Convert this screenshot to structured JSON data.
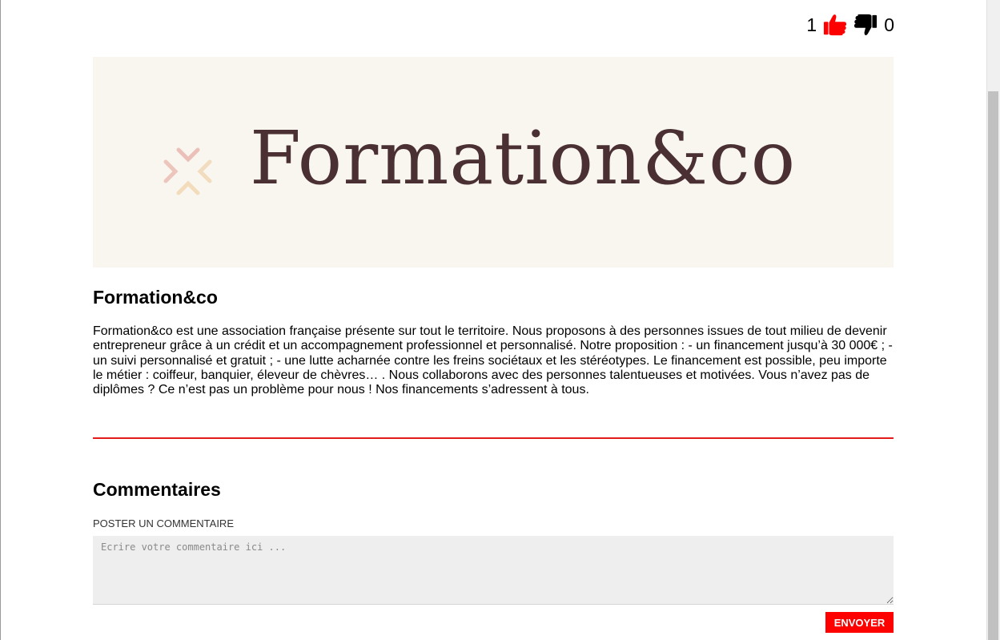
{
  "votes": {
    "likes": "1",
    "dislikes": "0",
    "like_icon": "thumbs-up-icon",
    "dislike_icon": "thumbs-down-icon",
    "like_color": "#ff0000",
    "dislike_color": "#000000"
  },
  "banner": {
    "logo_text": "Formation&co",
    "background": "#f9f6ef",
    "text_color": "#4b3033"
  },
  "article": {
    "title": "Formation&co",
    "description": "Formation&co est une association française présente sur tout le territoire. Nous proposons à des personnes issues de tout milieu de devenir entrepreneur grâce à un crédit et un accompagnement professionnel et personnalisé. Notre proposition : - un financement jusqu’à 30 000€ ; - un suivi personnalisé et gratuit ; - une lutte acharnée contre les freins sociétaux et les stéréotypes. Le financement est possible, peu importe le métier : coiffeur, banquier, éleveur de chèvres… . Nous collaborons avec des personnes talentueuses et motivées. Vous n’avez pas de diplômes ? Ce n’est pas un problème pour nous ! Nos financements s’adressent à tous."
  },
  "comments": {
    "title": "Commentaires",
    "post_label": "POSTER UN COMMENTAIRE",
    "input_placeholder": "Ecrire votre commentaire ici ...",
    "input_value": "",
    "send_label": "ENVOYER",
    "accent": "#ff0000"
  }
}
